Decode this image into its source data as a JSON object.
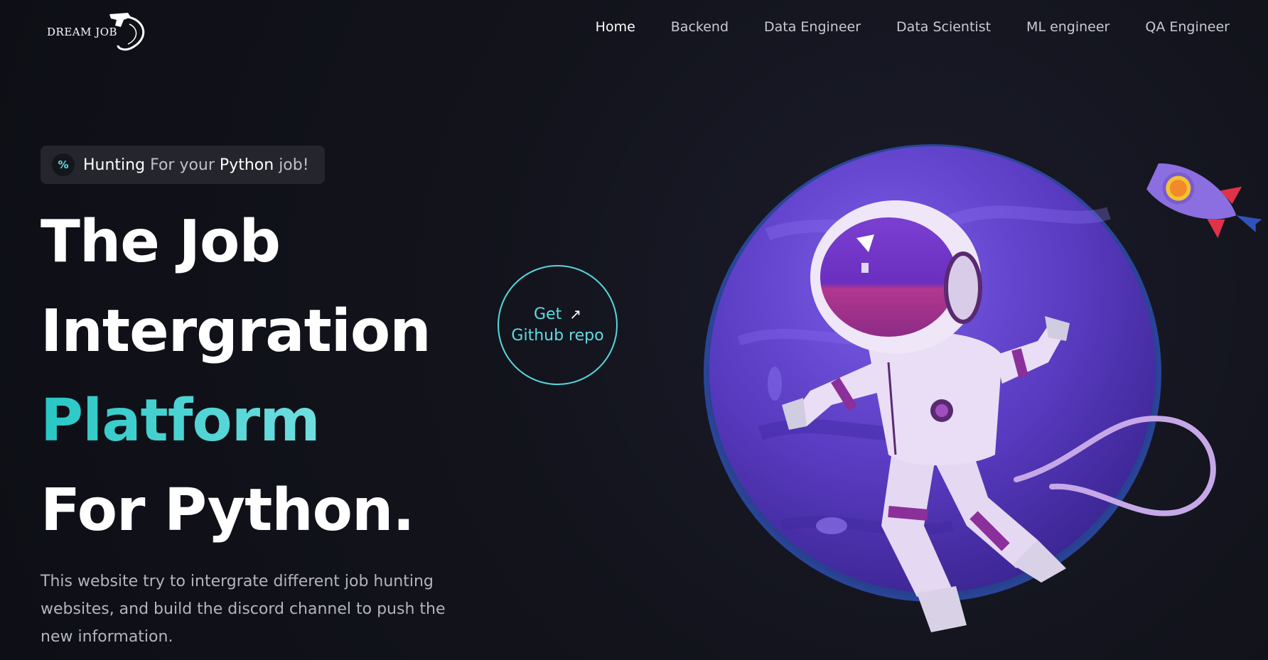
{
  "header": {
    "logo_text": "DREAM JOB",
    "nav": [
      {
        "label": "Home",
        "active": true
      },
      {
        "label": "Backend",
        "active": false
      },
      {
        "label": "Data Engineer",
        "active": false
      },
      {
        "label": "Data Scientist",
        "active": false
      },
      {
        "label": "ML engineer",
        "active": false
      },
      {
        "label": "QA Engineer",
        "active": false
      }
    ]
  },
  "hero": {
    "badge": {
      "icon": "percent-icon",
      "word1": "Hunting",
      "word2": "For your",
      "word3": "Python",
      "word4": "job!"
    },
    "headline": {
      "line1": "The Job",
      "line2": "Intergration",
      "line3": "Platform",
      "line4": "For Python."
    },
    "description": "This website try to intergrate different job hunting websites, and build the discord channel to push the new information.",
    "cta": {
      "line1": "Get",
      "line2": "Github repo",
      "icon": "arrow-up-right-icon"
    }
  },
  "colors": {
    "background": "#0f1017",
    "accent": "#5fdde2",
    "planet": "#5b3fc4"
  }
}
